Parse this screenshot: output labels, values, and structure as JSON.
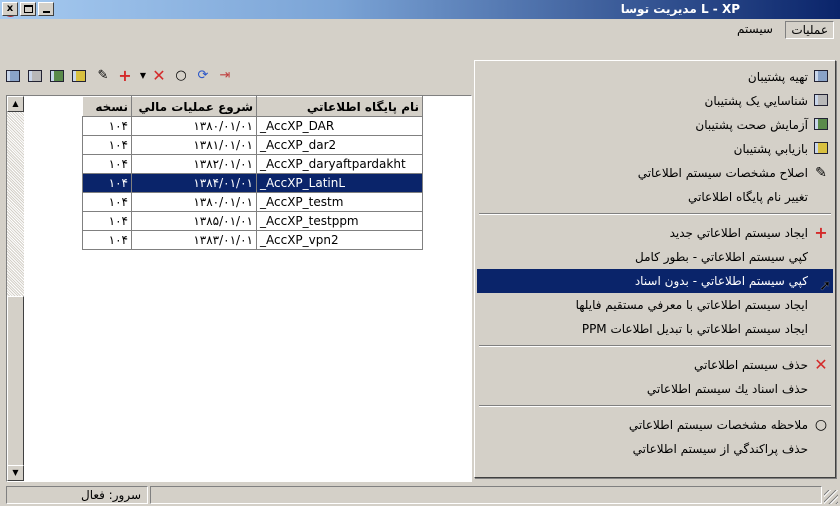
{
  "title": {
    "text": "L - XP مديريت توسا",
    "close": "x"
  },
  "menu": {
    "ops": "عمليات",
    "system": "سيستم"
  },
  "toolbar": {
    "icons": [
      "backup-icon",
      "identify-backup-icon",
      "verify-backup-icon",
      "restore-backup-icon",
      "edit-icon",
      "add-icon",
      "dropdown-arrow-icon",
      "delete-icon",
      "view-icon",
      "refresh-icon",
      "exit-icon"
    ]
  },
  "table": {
    "headers": {
      "name": "نام پايگاه اطلاعاتي",
      "start": "شروع عمليات مالي",
      "version": "نسخه"
    },
    "rows": [
      {
        "name": "_AccXP_DAR",
        "start": "۱۳۸۰/۰۱/۰۱",
        "version": "۱۰۴"
      },
      {
        "name": "_AccXP_dar2",
        "start": "۱۳۸۱/۰۱/۰۱",
        "version": "۱۰۴"
      },
      {
        "name": "_AccXP_daryaftpardakht",
        "start": "۱۳۸۲/۰۱/۰۱",
        "version": "۱۰۴"
      },
      {
        "name": "_AccXP_LatinL",
        "start": "۱۳۸۴/۰۱/۰۱",
        "version": "۱۰۴",
        "selected": true
      },
      {
        "name": "_AccXP_testm",
        "start": "۱۳۸۰/۰۱/۰۱",
        "version": "۱۰۴"
      },
      {
        "name": "_AccXP_testppm",
        "start": "۱۳۸۵/۰۱/۰۱",
        "version": "۱۰۴"
      },
      {
        "name": "_AccXP_vpn2",
        "start": "۱۳۸۳/۰۱/۰۱",
        "version": "۱۰۴"
      }
    ]
  },
  "status": {
    "server": "سرور: فعال"
  },
  "dropdown": {
    "items": [
      {
        "label": "تهيه پشتيبان",
        "icon": "backup-icon"
      },
      {
        "label": "شناسايي يک پشتيبان",
        "icon": "identify-backup-icon"
      },
      {
        "label": "آزمايش صحت پشتيبان",
        "icon": "verify-backup-icon"
      },
      {
        "label": "بازيابي پشتيبان",
        "icon": "restore-backup-icon"
      },
      {
        "label": "اصلاح مشخصات سيستم اطلاعاتي",
        "icon": "edit-icon"
      },
      {
        "label": "تغيير نام پايگاه اطلاعاتي"
      },
      {
        "label": "ايجاد سيستم اطلاعاتي جديد",
        "icon": "add-icon"
      },
      {
        "label": "کپي سيستم اطلاعاتي - بطور کامل"
      },
      {
        "label": "کپي سيستم اطلاعاتي - بدون اسناد",
        "selected": true
      },
      {
        "label": "ايجاد سيستم اطلاعاتي با معرفي مستقيم فايلها"
      },
      {
        "label": "ايجاد سيستم اطلاعاتي با تبديل اطلاعات PPM"
      },
      {
        "label": "حذف سيستم اطلاعاتي",
        "icon": "delete-icon"
      },
      {
        "label": "حذف اسناد يك سيستم اطلاعاتي"
      },
      {
        "label": "ملاحظه مشخصات سيستم اطلاعاتي",
        "icon": "view-icon"
      },
      {
        "label": "حذف پراکندگي از سيستم اطلاعاتي"
      }
    ]
  },
  "colors": {
    "selection": "#0a246a",
    "add": "#d42a2a",
    "delete": "#d42a2a",
    "refresh": "#2a56c8"
  }
}
